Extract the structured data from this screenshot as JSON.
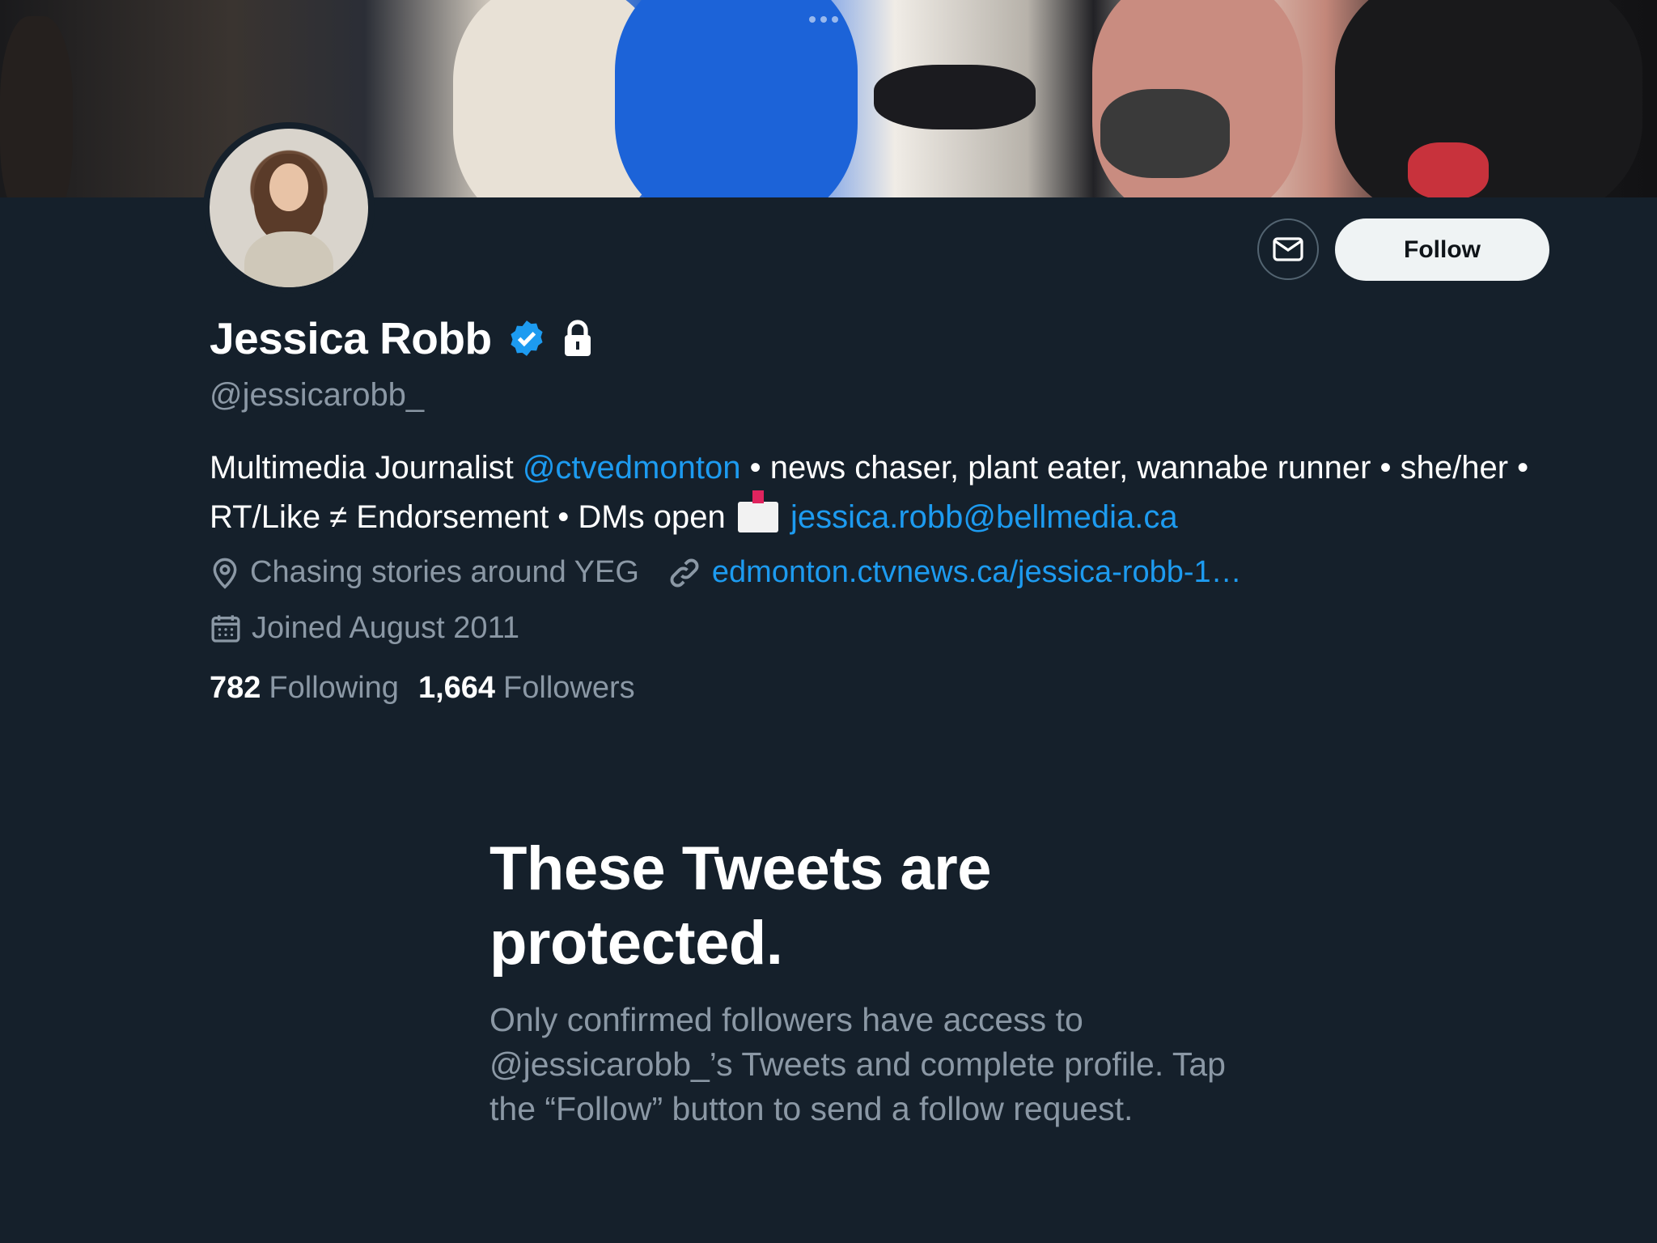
{
  "profile": {
    "name": "Jessica Robb",
    "handle": "@jessicarobb_",
    "follow_label": "Follow",
    "bio": {
      "part1": "Multimedia Journalist ",
      "mention": "@ctvedmonton",
      "part2": " • news chaser, plant eater, wannabe runner • she/her • RT/Like ≠ Endorsement • DMs open ",
      "email": "jessica.robb@bellmedia.ca"
    },
    "location": "Chasing stories around YEG",
    "website": "edmonton.ctvnews.ca/jessica-robb-1…",
    "joined": "Joined August 2011",
    "following_count": "782",
    "following_label": "Following",
    "followers_count": "1,664",
    "followers_label": "Followers"
  },
  "protected": {
    "title": "These Tweets are protected.",
    "body": "Only confirmed followers have access to @jessicarobb_’s Tweets and complete profile. Tap the “Follow” button to send a follow request."
  },
  "icons": {
    "verified": "verified-badge-icon",
    "lock": "lock-icon",
    "message": "envelope-icon",
    "location": "location-pin-icon",
    "link": "link-icon",
    "calendar": "calendar-icon",
    "email_emoji": "envelope-with-arrow-emoji"
  },
  "colors": {
    "background": "#15202b",
    "accent": "#1d9bf0",
    "secondary_text": "#8b98a5",
    "follow_button_bg": "#eff3f4"
  }
}
